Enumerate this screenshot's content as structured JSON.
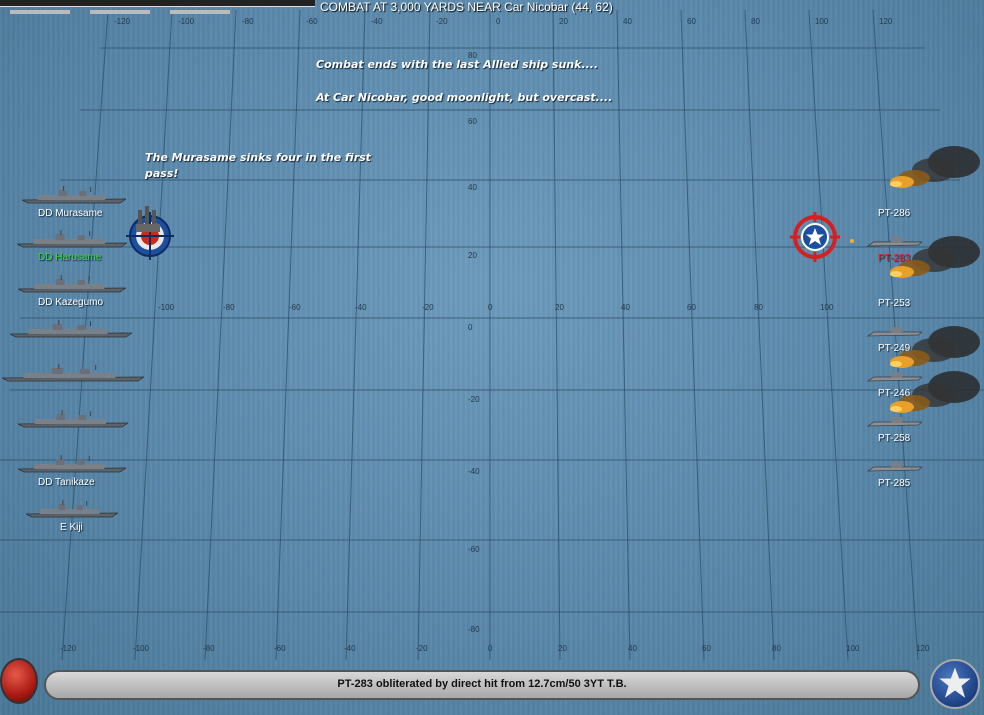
{
  "header": {
    "title": "COMBAT AT 3,000 YARDS NEAR Car Nicobar (44, 62)"
  },
  "messages": {
    "line1": "Combat ends with the last Allied ship sunk....",
    "line2": "At Car Nicobar, good moonlight, but overcast....",
    "line3": "The Murasame sinks four in the first pass!"
  },
  "grid": {
    "top_x_ticks": [
      "-120",
      "-100",
      "-80",
      "-60",
      "-40",
      "-20",
      "0",
      "20",
      "40",
      "60",
      "80",
      "100",
      "120"
    ],
    "mid_x_ticks": [
      "-100",
      "-80",
      "-60",
      "-40",
      "-20",
      "0",
      "20",
      "40",
      "60",
      "80",
      "100"
    ],
    "bottom_x_ticks": [
      "-120",
      "-100",
      "-80",
      "-60",
      "-40",
      "-20",
      "0",
      "20",
      "40",
      "60",
      "80",
      "100",
      "120"
    ],
    "y_ticks": [
      "80",
      "60",
      "40",
      "20",
      "0",
      "-20",
      "-40",
      "-60",
      "-80"
    ]
  },
  "japanese_ships": [
    {
      "label": "DD Murasame",
      "status": "normal"
    },
    {
      "label": "DD Harusame",
      "status": "selected"
    },
    {
      "label": "DD Kazegumo",
      "status": "normal"
    },
    {
      "label": "",
      "status": "normal"
    },
    {
      "label": "",
      "status": "normal"
    },
    {
      "label": "",
      "status": "normal"
    },
    {
      "label": "DD Tanikaze",
      "status": "normal"
    },
    {
      "label": "E Kiji",
      "status": "normal"
    }
  ],
  "allied_ships": [
    {
      "label": "PT-286",
      "status": "burning"
    },
    {
      "label": "PT-283",
      "status": "hit"
    },
    {
      "label": "PT-253",
      "status": "burning"
    },
    {
      "label": "PT-249",
      "status": "normal"
    },
    {
      "label": "PT-246",
      "status": "burning"
    },
    {
      "label": "PT-258",
      "status": "burning"
    },
    {
      "label": "PT-285",
      "status": "normal"
    }
  ],
  "status_bar": {
    "text": "PT-283 obliterated by direct hit from 12.7cm/50 3YT T.B."
  },
  "colors": {
    "sea": "#5a87a8",
    "selected_label": "#33dd33",
    "hit_label": "#e02222",
    "target_ring_red": "#d42020",
    "target_ring_blue": "#1d4fa0"
  }
}
